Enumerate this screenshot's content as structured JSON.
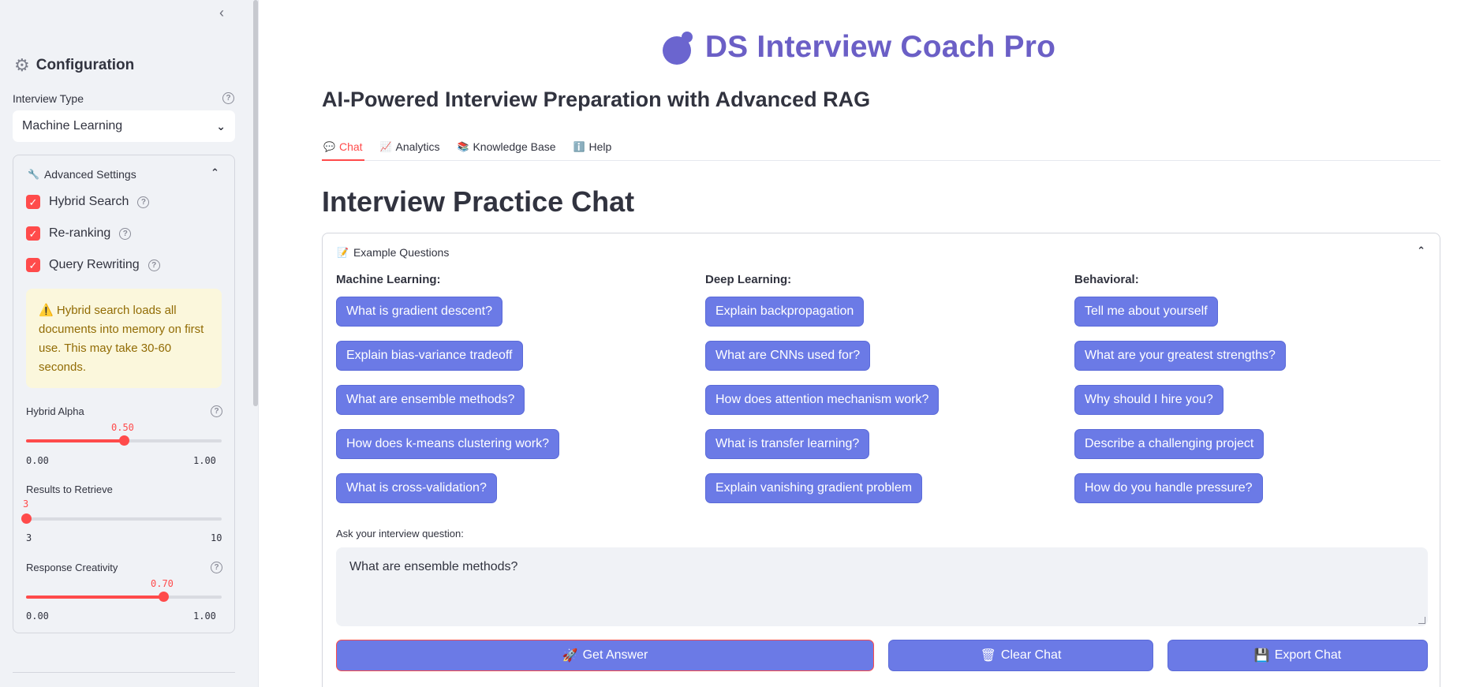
{
  "sidebar": {
    "collapse_glyph": "‹",
    "config_title": "Configuration",
    "interview_type": {
      "label": "Interview Type",
      "selected": "Machine Learning"
    },
    "advanced": {
      "title": "Advanced Settings",
      "checkboxes": [
        {
          "label": "Hybrid Search",
          "checked": true
        },
        {
          "label": "Re-ranking",
          "checked": true
        },
        {
          "label": "Query Rewriting",
          "checked": true
        }
      ],
      "warning": "Hybrid search loads all documents into memory on first use. This may take 30-60 seconds.",
      "sliders": [
        {
          "label": "Hybrid Alpha",
          "value": "0.50",
          "min": "0.00",
          "max": "1.00",
          "fraction": 0.5,
          "has_help": true
        },
        {
          "label": "Results to Retrieve",
          "value": "3",
          "min": "3",
          "max": "10",
          "fraction": 0.0,
          "has_help": false
        },
        {
          "label": "Response Creativity",
          "value": "0.70",
          "min": "0.00",
          "max": "1.00",
          "fraction": 0.7,
          "has_help": true
        }
      ]
    }
  },
  "header": {
    "title": "DS Interview Coach Pro",
    "subtitle": "AI-Powered Interview Preparation with Advanced RAG"
  },
  "tabs": [
    {
      "icon": "💬",
      "label": "Chat",
      "active": true
    },
    {
      "icon": "📈",
      "label": "Analytics",
      "active": false
    },
    {
      "icon": "📚",
      "label": "Knowledge Base",
      "active": false
    },
    {
      "icon": "ℹ️",
      "label": "Help",
      "active": false
    }
  ],
  "chat": {
    "title": "Interview Practice Chat",
    "examples": {
      "title": "Example Questions",
      "columns": [
        {
          "heading": "Machine Learning:",
          "questions": [
            "What is gradient descent?",
            "Explain bias-variance tradeoff",
            "What are ensemble methods?",
            "How does k-means clustering work?",
            "What is cross-validation?"
          ]
        },
        {
          "heading": "Deep Learning:",
          "questions": [
            "Explain backpropagation",
            "What are CNNs used for?",
            "How does attention mechanism work?",
            "What is transfer learning?",
            "Explain vanishing gradient problem"
          ]
        },
        {
          "heading": "Behavioral:",
          "questions": [
            "Tell me about yourself",
            "What are your greatest strengths?",
            "Why should I hire you?",
            "Describe a challenging project",
            "How do you handle pressure?"
          ]
        }
      ]
    },
    "ask_label": "Ask your interview question:",
    "question_value": "What are ensemble methods?",
    "buttons": {
      "get_answer": "Get Answer",
      "clear_chat": "Clear Chat",
      "export_chat": "Export Chat"
    },
    "button_icons": {
      "get_answer": "🚀",
      "clear_chat": "🗑",
      "export_chat": "💾"
    }
  },
  "colors": {
    "accent": "#ff4b4b",
    "button": "#6b7ae6",
    "title": "#6b5fc6",
    "warning_bg": "#fbf7dc",
    "warning_text": "#926c05"
  }
}
